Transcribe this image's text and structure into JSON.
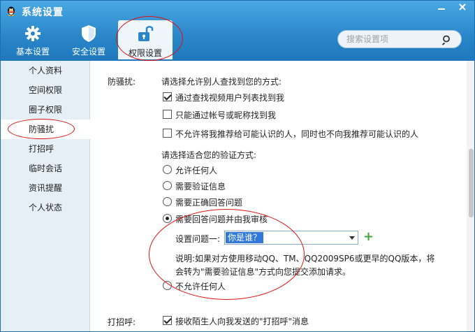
{
  "window": {
    "title": "系统设置"
  },
  "tabs": [
    {
      "label": "基本设置",
      "icon": "gear-icon"
    },
    {
      "label": "安全设置",
      "icon": "shield-icon"
    },
    {
      "label": "权限设置",
      "icon": "unlock-icon"
    }
  ],
  "search": {
    "placeholder": "搜索设置项"
  },
  "sidebar": {
    "items": [
      {
        "label": "个人资料"
      },
      {
        "label": "空间权限"
      },
      {
        "label": "圈子权限"
      },
      {
        "label": "防骚扰"
      },
      {
        "label": "打招呼"
      },
      {
        "label": "临时会话"
      },
      {
        "label": "资讯提醒"
      },
      {
        "label": "个人状态"
      }
    ]
  },
  "harassment": {
    "label": "防骚扰:",
    "find_prompt": "请选择允许别人查找到您的方式:",
    "find_options": [
      {
        "label": "通过查找视频用户列表找到我",
        "checked": true
      },
      {
        "label": "只能通过帐号或昵称找到我",
        "checked": false
      },
      {
        "label": "不允许将我推荐给可能认识的人，同时也不向我推荐可能认识的人",
        "checked": false
      }
    ],
    "verify_prompt": "请选择适合您的验证方式:",
    "verify_options": [
      {
        "label": "允许任何人",
        "selected": false
      },
      {
        "label": "需要验证信息",
        "selected": false
      },
      {
        "label": "需要正确回答问题",
        "selected": false
      },
      {
        "label": "需要回答问题并由我审核",
        "selected": true
      }
    ],
    "question_label": "设置问题一:",
    "question_value": "你是谁？",
    "note_line1": "说明:如果对方使用移动QQ、TM、QQ2009SP6或更早的QQ版本，将",
    "note_line2": "会转为\"需要验证信息\"方式向您提交添加请求。",
    "deny_all": {
      "label": "不允许任何人",
      "selected": false
    }
  },
  "greeting": {
    "label": "打招呼:",
    "option": {
      "label": "接收陌生人向我发送的\"打招呼\"消息",
      "checked": true
    }
  },
  "colors": {
    "header": "#2a86c9",
    "sidebar": "#e6eef6",
    "annotation": "#dd1111",
    "selection": "#3079d8"
  }
}
